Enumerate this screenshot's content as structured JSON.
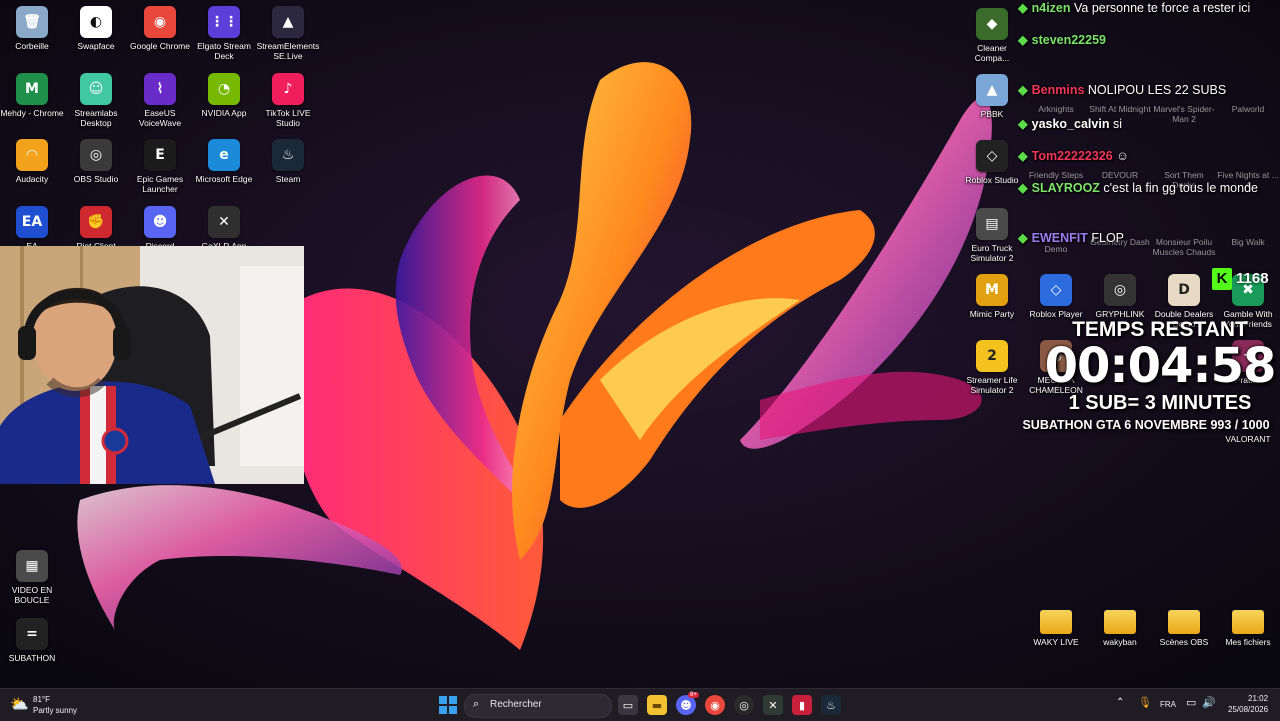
{
  "desktop_icons": [
    {
      "label": "Corbeille",
      "color": "#8aa9c9",
      "glyph": "🗑"
    },
    {
      "label": "Swapface",
      "color": "#ffffff",
      "glyph": "◐"
    },
    {
      "label": "Google Chrome",
      "color": "#e9473b",
      "glyph": "◉"
    },
    {
      "label": "Elgato Stream Deck",
      "color": "#5a3fd8",
      "glyph": "⋮⋮"
    },
    {
      "label": "StreamElements SE.Live",
      "color": "#2b2840",
      "glyph": "▲"
    },
    {
      "label": "Mehdy - Chrome",
      "color": "#1f8f4a",
      "glyph": "M"
    },
    {
      "label": "Streamlabs Desktop",
      "color": "#42c8a0",
      "glyph": "☺"
    },
    {
      "label": "EaseUS VoiceWave",
      "color": "#6a2cc8",
      "glyph": "⌇"
    },
    {
      "label": "NVIDIA App",
      "color": "#76b900",
      "glyph": "◔"
    },
    {
      "label": "TikTok LIVE Studio",
      "color": "#f01e5a",
      "glyph": "♪"
    },
    {
      "label": "Audacity",
      "color": "#f2a21b",
      "glyph": "◠"
    },
    {
      "label": "OBS Studio",
      "color": "#3a3a3a",
      "glyph": "◎"
    },
    {
      "label": "Epic Games Launcher",
      "color": "#1b1b1b",
      "glyph": "E"
    },
    {
      "label": "Microsoft Edge",
      "color": "#1c8ad8",
      "glyph": "e"
    },
    {
      "label": "Steam",
      "color": "#1b2838",
      "glyph": "♨"
    },
    {
      "label": "EA",
      "color": "#1f4fd0",
      "glyph": "EA"
    },
    {
      "label": "Riot Client",
      "color": "#d0282f",
      "glyph": "✊"
    },
    {
      "label": "Discord",
      "color": "#5865f2",
      "glyph": "☻"
    },
    {
      "label": "GoXLR App",
      "color": "#2f2f2f",
      "glyph": "✕"
    },
    {
      "label": "VIDEO EN BOUCLE",
      "color": "#4a4a4a",
      "glyph": "▦"
    },
    {
      "label": "SUBATHON",
      "color": "#222222",
      "glyph": "="
    }
  ],
  "right_icons": [
    {
      "label": "Cleaner Compa...",
      "color": "#3a6b2a",
      "glyph": "◆"
    },
    {
      "label": "PBBK",
      "color": "#7aa6d8",
      "glyph": "▲"
    },
    {
      "label": "Roblox Studio",
      "color": "#222222",
      "glyph": "◇"
    },
    {
      "label": "Euro Truck Simulator 2",
      "color": "#4a4a4a",
      "glyph": "▤"
    },
    {
      "label": "Mimic Party",
      "color": "#e0a010",
      "glyph": "M"
    },
    {
      "label": "Roblox Player",
      "color": "#2d6cdf",
      "glyph": "◇"
    },
    {
      "label": "GRYPHLINK",
      "color": "#333333",
      "glyph": "◎"
    },
    {
      "label": "Double Dealers Demo",
      "color": "#e8d9c4",
      "glyph": "D"
    },
    {
      "label": "Gamble With Your Friends",
      "color": "#1a9a58",
      "glyph": "✖"
    },
    {
      "label": "Streamer Life Simulator 2",
      "color": "#f3c21f",
      "glyph": "2"
    },
    {
      "label": "MECCHA CHAMELEON",
      "color": "#8a5a44",
      "glyph": "◍"
    },
    {
      "label": "Pratfall",
      "color": "#8a2a5a",
      "glyph": "✦"
    },
    {
      "label": "VALORANT",
      "color": "#e84055",
      "glyph": "V"
    }
  ],
  "right_icons_ghost": [
    "Arknights",
    "Shift At Midnight",
    "Marvel's Spider-Man 2",
    "Palworld",
    "Friendly Steps",
    "DEVOUR",
    "Sort Them Ducks",
    "Five Nights at ... 4",
    "Demo",
    "Geometry Dash",
    "Monsieur Poilu Muscles Chauds",
    "Big Walk"
  ],
  "bottom_folders": [
    {
      "label": "WAKY LIVE"
    },
    {
      "label": "wakyban"
    },
    {
      "label": "Scènes OBS"
    },
    {
      "label": "Mes fichiers"
    }
  ],
  "chat": [
    {
      "user": "n4izen",
      "user_color": "#7ee36a",
      "text": "Va personne te force a rester ici"
    },
    {
      "user": "steven22259",
      "user_color": "#7ee36a",
      "text": ""
    },
    {
      "user": "Benmins",
      "user_color": "#f2365a",
      "text": "NOLIPOU LES 22 SUBS"
    },
    {
      "user": "yasko_calvin",
      "user_color": "#ffffff",
      "text": "si"
    },
    {
      "user": "Tom22222326",
      "user_color": "#f2365a",
      "text": "☺"
    },
    {
      "user": "SLAYROOZ",
      "user_color": "#7ee36a",
      "text": "c'est la fin gg tous le monde"
    },
    {
      "user": "EWENFIT",
      "user_color": "#9a7df0",
      "text": "FLOP"
    }
  ],
  "kick_viewers": "1168",
  "subathon": {
    "title": "TEMPS RESTANT",
    "time": "00:04:58",
    "rule": "1 SUB= 3 MINUTES",
    "goal": "SUBATHON GTA 6 NOVEMBRE 993 / 1000"
  },
  "taskbar": {
    "weather_temp": "81°F",
    "weather_desc": "Partly sunny",
    "search_placeholder": "Rechercher",
    "language": "FRA",
    "time": "21:02",
    "date": "25/08/2026",
    "discord_badge": "9+"
  }
}
